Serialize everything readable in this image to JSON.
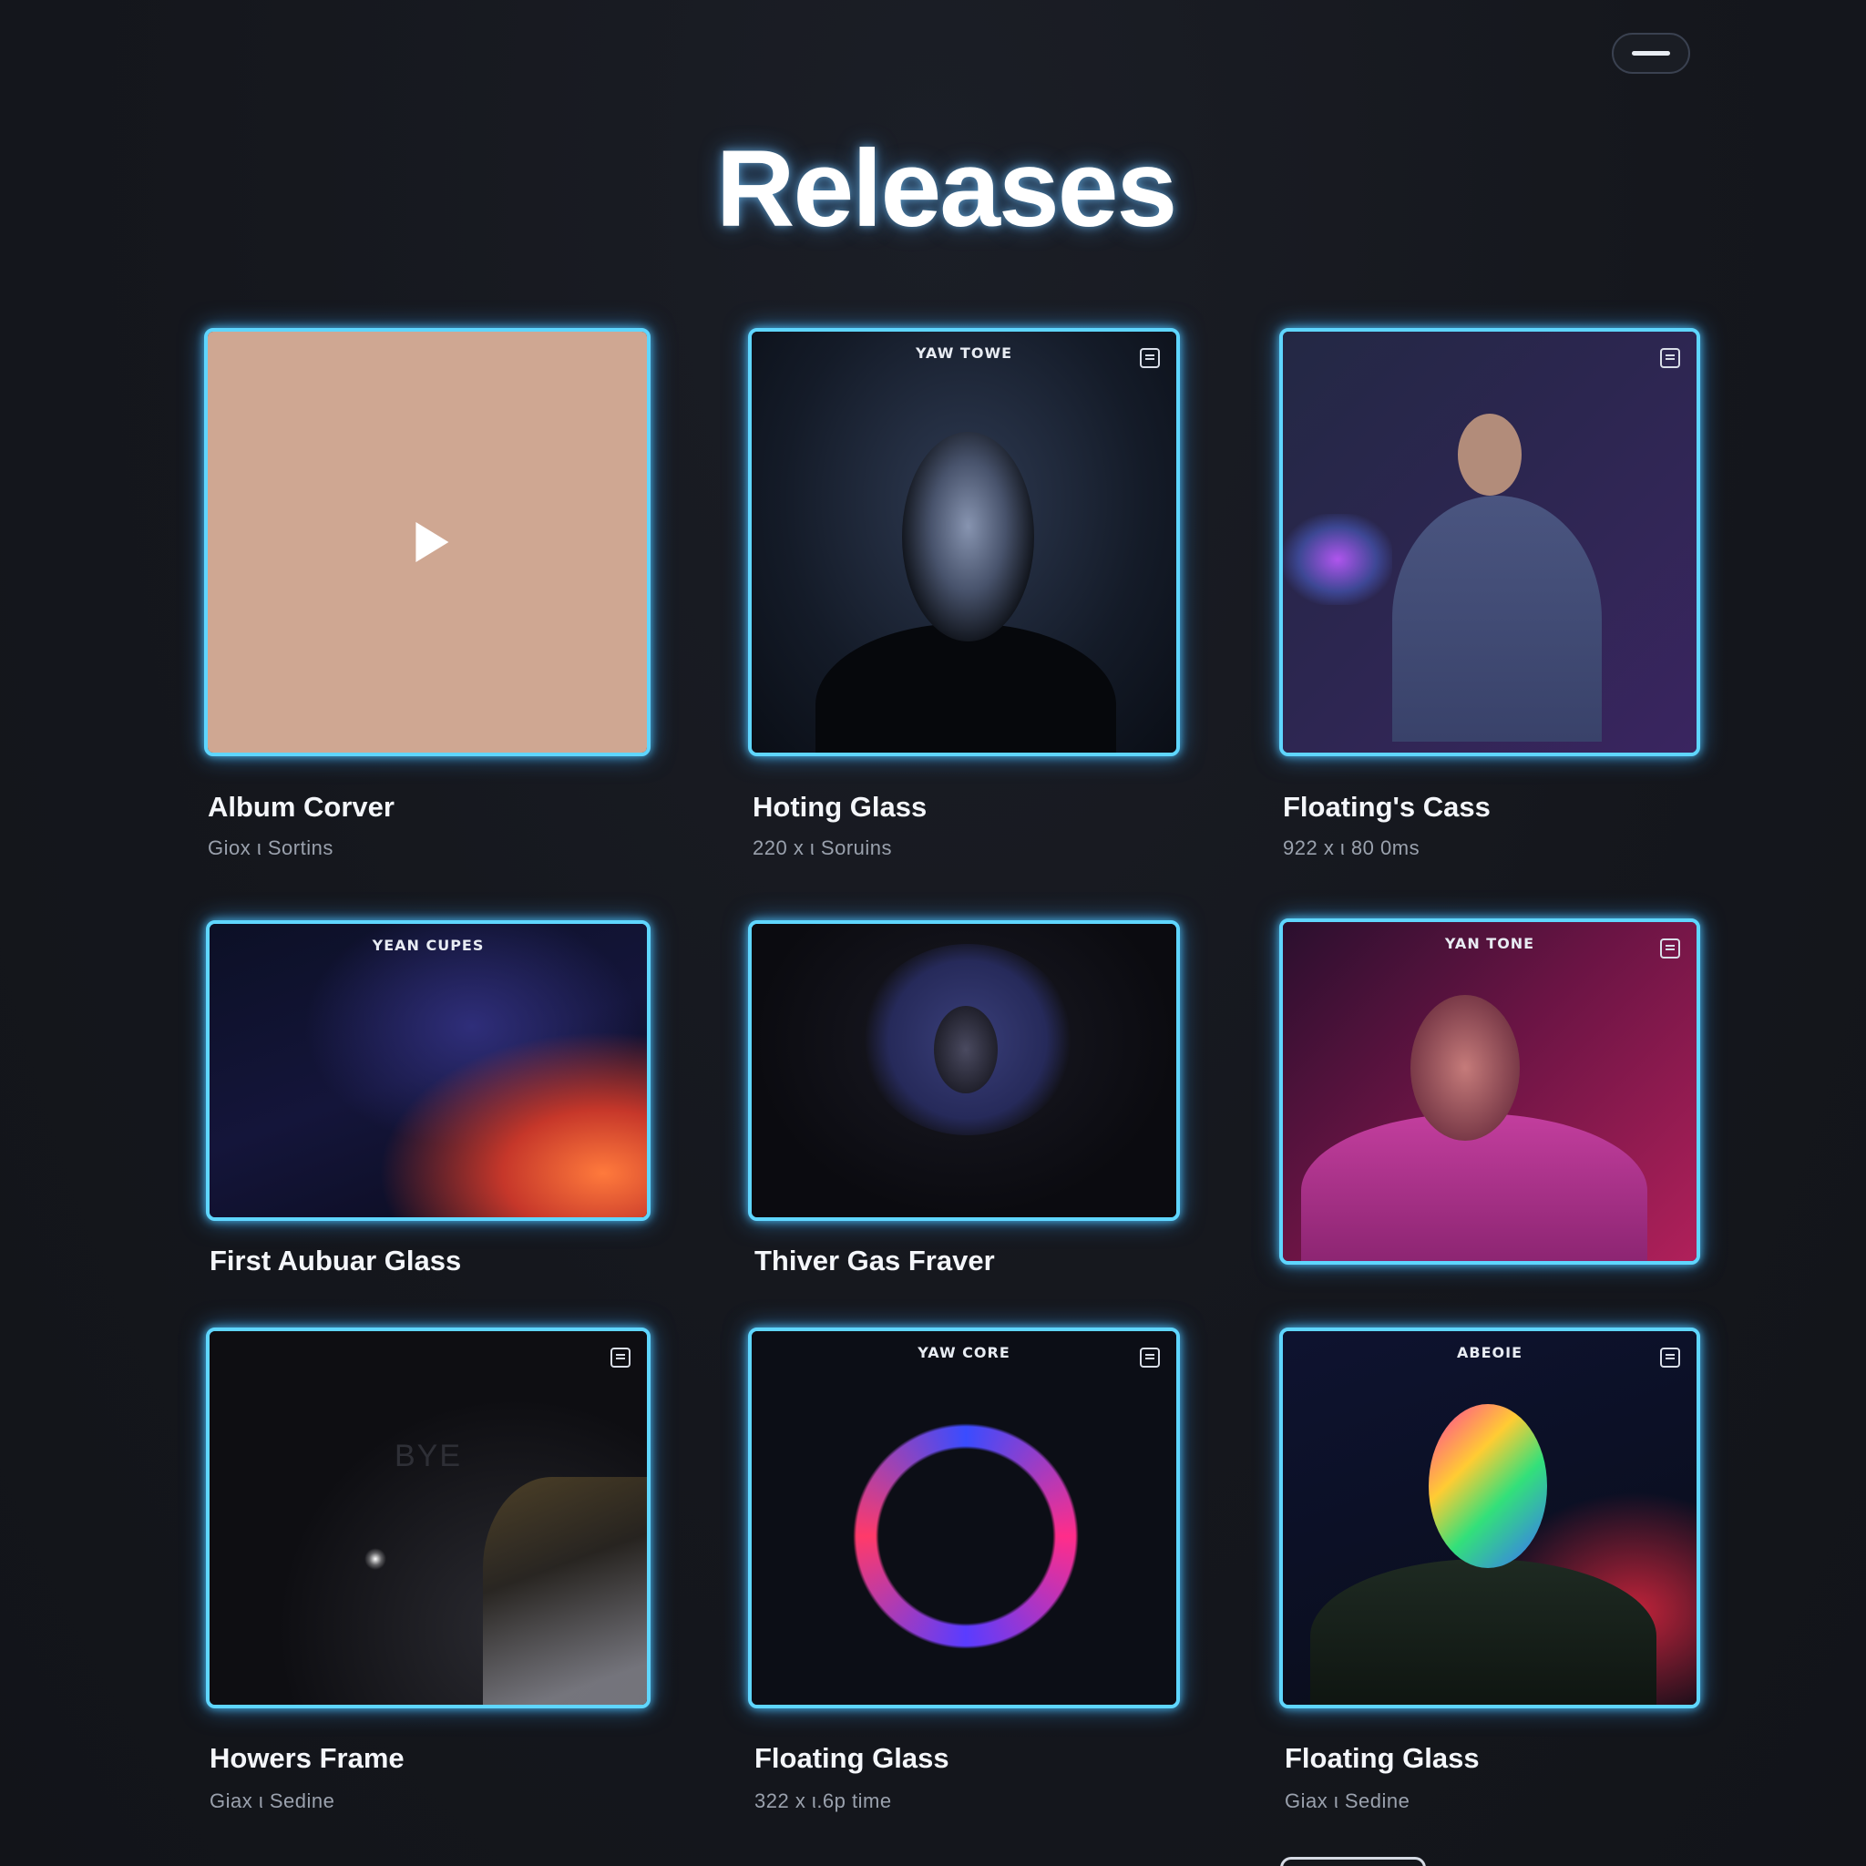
{
  "header": {
    "title": "Releases",
    "menu_icon": "hamburger-icon"
  },
  "releases": [
    {
      "title": "Album Corver",
      "meta": "Giox ι Sortins",
      "cover_label": "",
      "cover_text": "",
      "badge": false
    },
    {
      "title": "Hoting Glass",
      "meta": "220 x ι Soruins",
      "cover_label": "YAW TOWE",
      "cover_text": "",
      "badge": true
    },
    {
      "title": "Floating's Cass",
      "meta": "922 x ι 80 0ms",
      "cover_label": "",
      "cover_text": "",
      "badge": true
    },
    {
      "title": "First Aubuar Glass",
      "meta": "",
      "cover_label": "YEAN CUPES",
      "cover_text": "",
      "badge": false
    },
    {
      "title": "Thiver Gas Fraver",
      "meta": "",
      "cover_label": "",
      "cover_text": "",
      "badge": false
    },
    {
      "title": "",
      "meta": "",
      "cover_label": "YAN TONE",
      "cover_text": "",
      "badge": true
    },
    {
      "title": "Howers Frame",
      "meta": "Giax ι Sedine",
      "cover_label": "",
      "cover_text": "BYE",
      "badge": true
    },
    {
      "title": "Floating Glass",
      "meta": "322 x ι.6p time",
      "cover_label": "YAW CORE",
      "cover_text": "",
      "badge": true
    },
    {
      "title": "Floating Glass",
      "meta": "Giax ι Sedine",
      "cover_label": "ABEOIE",
      "cover_text": "",
      "badge": true
    }
  ],
  "colors": {
    "background": "#15171d",
    "accent_glow": "#5fd6ff",
    "album_cover_fill": "#cfa792"
  }
}
